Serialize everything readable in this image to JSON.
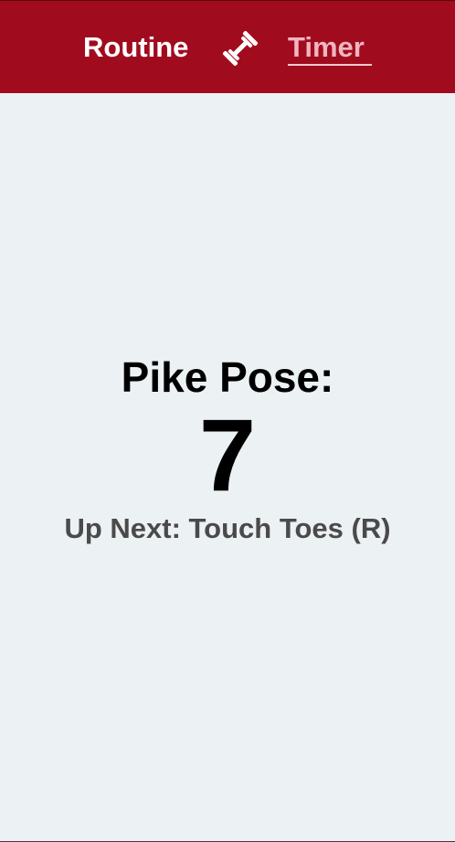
{
  "nav": {
    "routine_label": "Routine",
    "logo_icon": "dumbbell-icon",
    "timer_label": "Timer",
    "active_tab": "Timer"
  },
  "timer": {
    "exercise": "Pike Pose:",
    "seconds_remaining": "7",
    "up_next": "Up Next: Touch Toes (R)"
  },
  "colors": {
    "nav_background": "#a10b1e",
    "page_background": "#ecf1f4",
    "active_tab_text": "#f0b6c0",
    "up_next_text": "#4a4a4a"
  }
}
